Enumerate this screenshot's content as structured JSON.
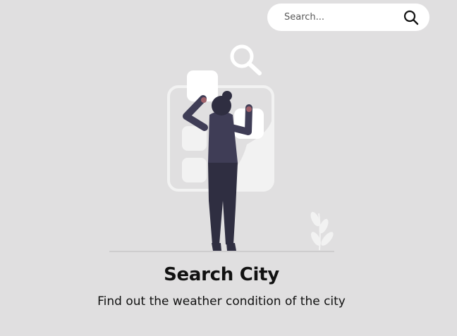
{
  "search": {
    "placeholder": "Search...",
    "value": "",
    "button_icon": "search-icon"
  },
  "empty_state": {
    "illustration_icon": "person-searching-illustration",
    "title": "Search City",
    "subtitle": "Find out the weather condition of the city"
  },
  "colors": {
    "background": "#e0dfe0",
    "search_bar": "#ffffff",
    "figure_dark": "#2f2e41",
    "figure_shirt": "#3f3d56",
    "skin": "#a0616a",
    "panel_light": "#f2f2f2",
    "title_text": "#111111"
  }
}
